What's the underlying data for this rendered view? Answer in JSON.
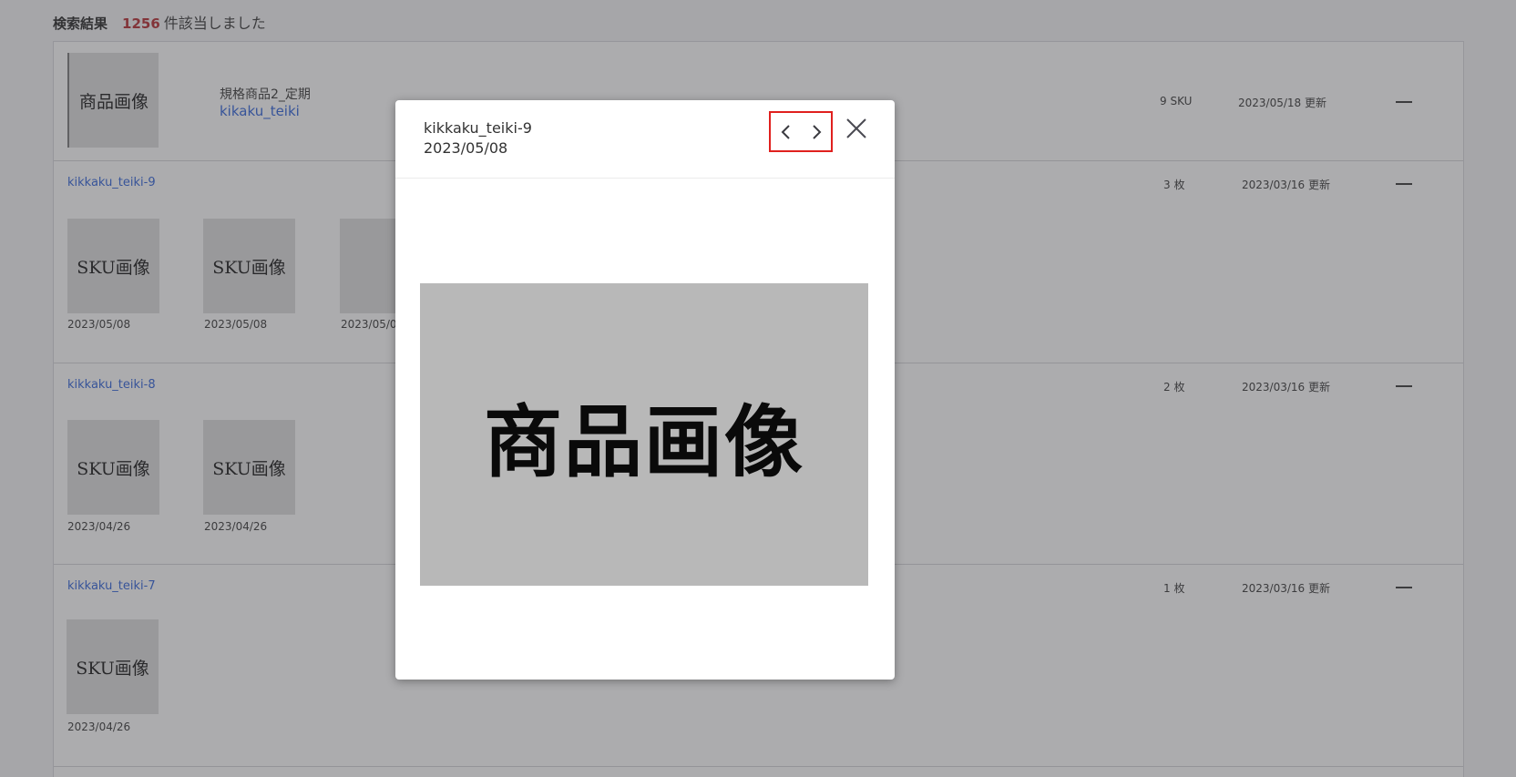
{
  "summary": {
    "label": "検索結果",
    "count": "1256",
    "suffix": "件該当しました"
  },
  "product": {
    "thumb_label": "商品画像",
    "name": "規格商品2_定期",
    "code": "kikaku_teiki",
    "sku_count": "9 SKU",
    "updated": "2023/05/18 更新"
  },
  "sku_rows": [
    {
      "code": "kikkaku_teiki-9",
      "count": "3 枚",
      "updated": "2023/03/16 更新",
      "images": [
        {
          "label": "SKU画像",
          "date": "2023/05/08"
        },
        {
          "label": "SKU画像",
          "date": "2023/05/08"
        },
        {
          "label": "",
          "date": "2023/05/08"
        }
      ]
    },
    {
      "code": "kikkaku_teiki-8",
      "count": "2 枚",
      "updated": "2023/03/16 更新",
      "images": [
        {
          "label": "SKU画像",
          "date": "2023/04/26"
        },
        {
          "label": "SKU画像",
          "date": "2023/04/26"
        }
      ]
    },
    {
      "code": "kikkaku_teiki-7",
      "count": "1 枚",
      "updated": "2023/03/16 更新",
      "images": [
        {
          "label": "SKU画像",
          "date": "2023/04/26"
        }
      ]
    }
  ],
  "modal": {
    "title": "kikkaku_teiki-9",
    "date": "2023/05/08",
    "image_label": "商品画像",
    "prev_icon": "chevron-left-icon",
    "next_icon": "chevron-right-icon",
    "close_icon": "close-icon",
    "highlight_color": "#e0201e"
  }
}
